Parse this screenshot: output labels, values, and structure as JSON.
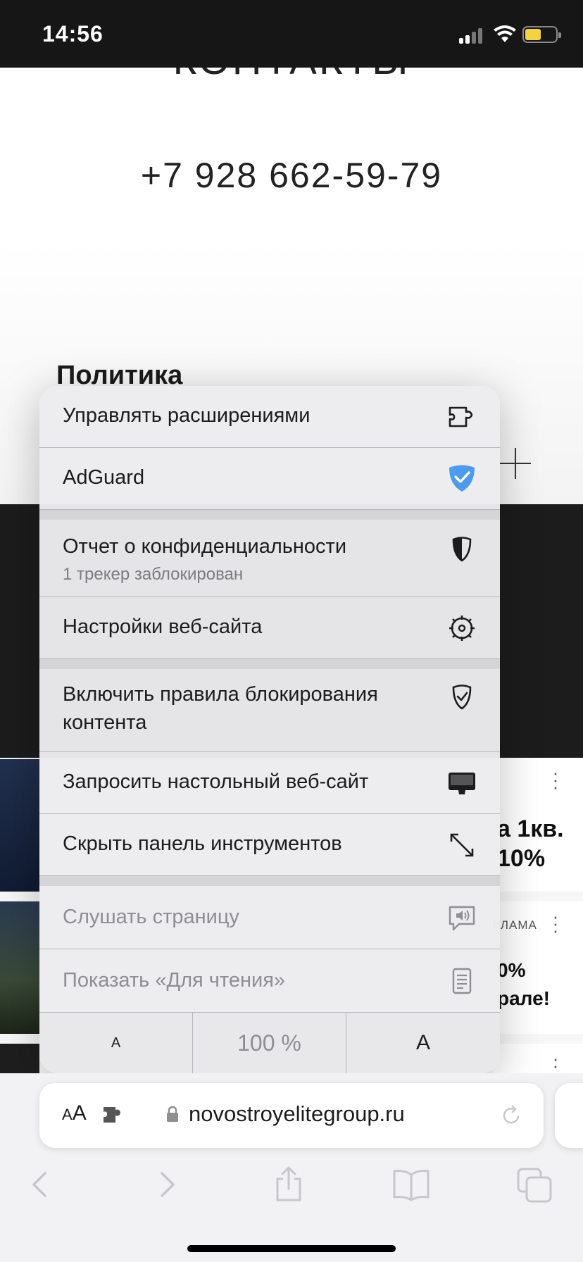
{
  "status_bar": {
    "time": "14:56",
    "battery_color": "#f5d33e"
  },
  "page": {
    "heading": "КОНТАКТЫ",
    "phone": "+7 928 662-59-79",
    "policy": "Политика"
  },
  "feed": {
    "card1_text_line1": "а 1кв.",
    "card1_text_line2": "10%",
    "card2_label": "КЛАМА",
    "card2_text_line1": "0%",
    "card2_text_line2": "рале!"
  },
  "menu": {
    "manage_extensions": "Управлять расширениями",
    "adguard": "AdGuard",
    "privacy_report": "Отчет о конфиденциальности",
    "privacy_report_sub": "1 трекер заблокирован",
    "website_settings": "Настройки веб-сайта",
    "content_blockers_line1": "Включить правила блокирования",
    "content_blockers_line2": "контента",
    "request_desktop": "Запросить настольный веб-сайт",
    "hide_toolbar": "Скрыть панель инструментов",
    "listen_page": "Слушать страницу",
    "show_reader": "Показать «Для чтения»",
    "zoom_smaller": "A",
    "zoom_level": "100 %",
    "zoom_larger": "A",
    "adguard_color": "#4b9bf0"
  },
  "address_bar": {
    "format_label_small": "A",
    "format_label_large": "A",
    "host": "novostroyelitegroup.ru"
  },
  "icons": [
    "puzzle-icon",
    "adguard-shield-icon",
    "privacy-shield-icon",
    "gear-icon",
    "shield-check-icon",
    "desktop-icon",
    "expand-arrows-icon",
    "speaker-bubble-icon",
    "reader-page-icon",
    "lock-icon",
    "reload-icon",
    "back-icon",
    "forward-icon",
    "share-icon",
    "bookmarks-icon",
    "tabs-icon"
  ]
}
